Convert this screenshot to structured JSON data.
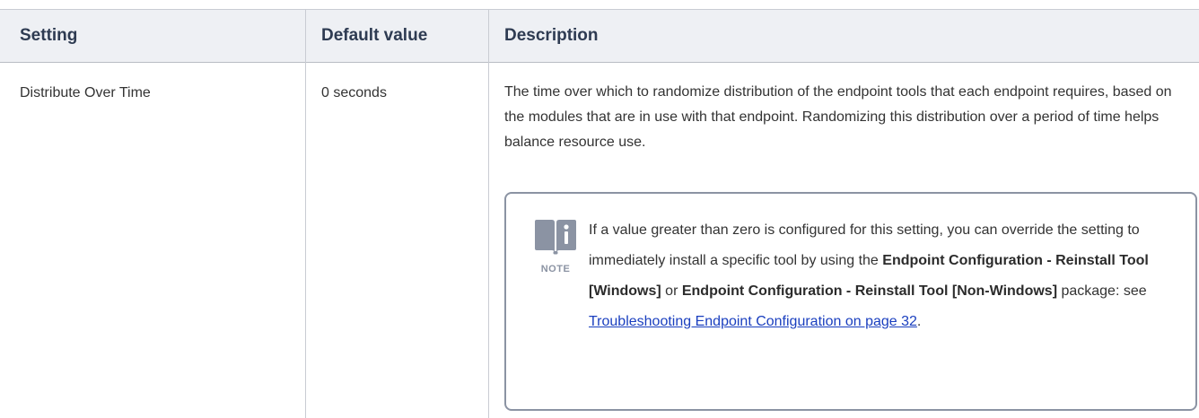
{
  "table": {
    "headers": {
      "setting": "Setting",
      "default_value": "Default value",
      "description": "Description"
    },
    "rows": [
      {
        "setting": "Distribute Over Time",
        "default_value": "0 seconds",
        "description": "The time over which to randomize distribution of the endpoint tools that each endpoint requires, based on the modules that are in use with that endpoint. Randomizing this distribution over a period of time helps balance resource use.",
        "note": {
          "label": "NOTE",
          "text_1": "If a value greater than zero is configured for this setting, you can override the setting to immediately install a specific tool by using the ",
          "bold_1": "Endpoint Configuration - Reinstall Tool [Windows]",
          "text_2": " or ",
          "bold_2": "Endpoint Configuration - Reinstall Tool [Non-Windows]",
          "text_3": " package: see ",
          "link": "Troubleshooting Endpoint Configuration on page 32",
          "text_4": "."
        }
      }
    ]
  },
  "colors": {
    "header_bg": "#eef0f4",
    "header_text": "#2e3b52",
    "note_border": "#8b93a3",
    "link": "#1a3fbf"
  },
  "icons": {
    "note": "book-info-icon"
  }
}
